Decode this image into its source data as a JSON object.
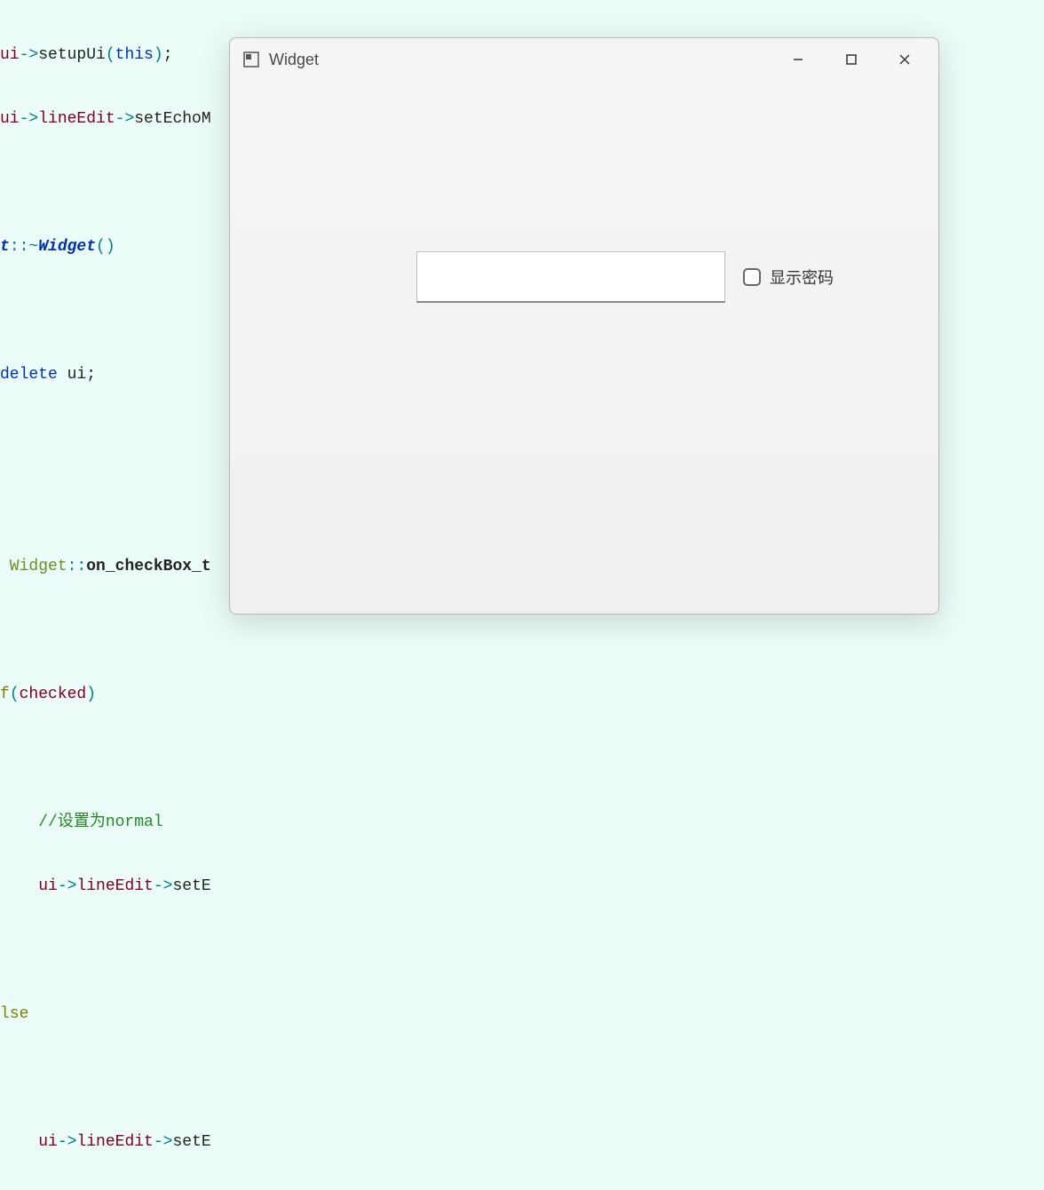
{
  "code": {
    "line1_pre": "ui",
    "line1_op1": "->",
    "line1_func": "setupUi",
    "line1_p1": "(",
    "line1_this": "this",
    "line1_p2": ")",
    "line1_semi": ";",
    "line2_pre": "ui",
    "line2_op1": "->",
    "line2_member": "lineEdit",
    "line2_op2": "->",
    "line2_func": "setEchoM",
    "line3_class": "t",
    "line3_scope": "::~",
    "line3_dtor": "Widget",
    "line3_p1": "(",
    "line3_p2": ")",
    "line4_delete": "delete",
    "line4_ui": " ui",
    "line4_semi": ";",
    "line5_class": " Widget",
    "line5_scope": "::",
    "line5_func": "on_checkBox_t",
    "line6_if": "f",
    "line6_p1": "(",
    "line6_checked": "checked",
    "line6_p2": ")",
    "line7_comment": "//设置为normal",
    "line8_ui": "ui",
    "line8_op1": "->",
    "line8_member": "lineEdit",
    "line8_op2": "->",
    "line8_func": "setE",
    "line9_else": "lse",
    "line10_ui": "ui",
    "line10_op1": "->",
    "line10_member": "lineEdit",
    "line10_op2": "->",
    "line10_func": "setE"
  },
  "window": {
    "title": "Widget",
    "checkbox_label": "显示密码"
  }
}
